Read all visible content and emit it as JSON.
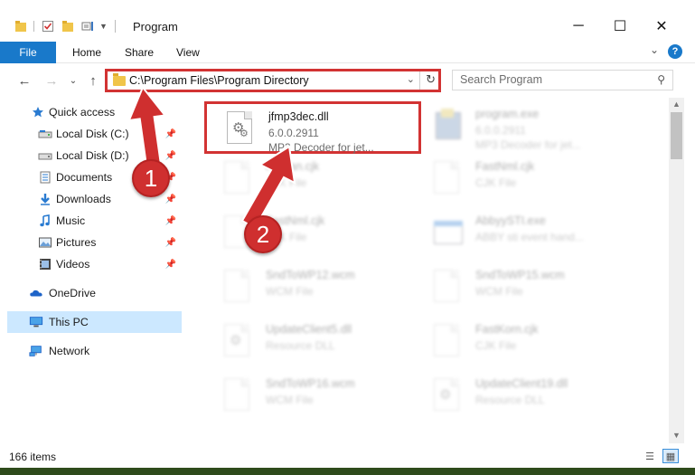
{
  "window": {
    "title": "Program"
  },
  "titlebar": {
    "minimize": "─",
    "maximize": "☐",
    "close": "✕"
  },
  "ribbon": {
    "file": "File",
    "tabs": [
      "Home",
      "Share",
      "View"
    ],
    "help": "?"
  },
  "nav": {
    "address": "C:\\Program Files\\Program Directory",
    "search_placeholder": "Search Program"
  },
  "sidebar": {
    "quick_access": "Quick access",
    "pinned": [
      {
        "label": "Local Disk (C:)",
        "icon": "drive-icon"
      },
      {
        "label": "Local Disk (D:)",
        "icon": "drive-icon"
      },
      {
        "label": "Documents",
        "icon": "documents-icon"
      },
      {
        "label": "Downloads",
        "icon": "downloads-icon"
      },
      {
        "label": "Music",
        "icon": "music-icon"
      },
      {
        "label": "Pictures",
        "icon": "pictures-icon"
      },
      {
        "label": "Videos",
        "icon": "videos-icon"
      }
    ],
    "onedrive": "OneDrive",
    "this_pc": "This PC",
    "network": "Network"
  },
  "files": [
    {
      "name": "jfmp3dec.dll",
      "line1": "6.0.0.2911",
      "line2": "MP3 Decoder for jet...",
      "icon": "dll-gear-icon",
      "highlight": true
    },
    {
      "name": "program.exe",
      "line1": "6.0.0.2911",
      "line2": "MP3 Decoder for jet...",
      "icon": "exe-icon"
    },
    {
      "name": "Korean.cjk",
      "line1": "CJK File",
      "line2": "",
      "icon": "file-icon"
    },
    {
      "name": "FastNml.cjk",
      "line1": "CJK File",
      "line2": "",
      "icon": "file-icon"
    },
    {
      "name": "FastNml.cjk",
      "line1": "CJK File",
      "line2": "",
      "icon": "file-icon"
    },
    {
      "name": "AbbyySTI.exe",
      "line1": "ABBY sti event hand...",
      "line2": "",
      "icon": "exe-window-icon"
    },
    {
      "name": "SndToWP12.wcm",
      "line1": "WCM File",
      "line2": "",
      "icon": "file-icon"
    },
    {
      "name": "SndToWP15.wcm",
      "line1": "WCM File",
      "line2": "",
      "icon": "file-icon"
    },
    {
      "name": "UpdateClient5.dll",
      "line1": "Resource DLL",
      "line2": "",
      "icon": "dll-gear-icon"
    },
    {
      "name": "FastKorn.cjk",
      "line1": "CJK File",
      "line2": "",
      "icon": "file-icon"
    },
    {
      "name": "SndToWP16.wcm",
      "line1": "WCM File",
      "line2": "",
      "icon": "file-icon"
    },
    {
      "name": "UpdateClient19.dll",
      "line1": "Resource DLL",
      "line2": "",
      "icon": "dll-gear-icon"
    }
  ],
  "status": {
    "count": "166 items"
  },
  "callouts": {
    "one": "1",
    "two": "2"
  },
  "colors": {
    "accent": "#1979ca",
    "callout": "#cf2f2f",
    "selection": "#cce8ff"
  }
}
